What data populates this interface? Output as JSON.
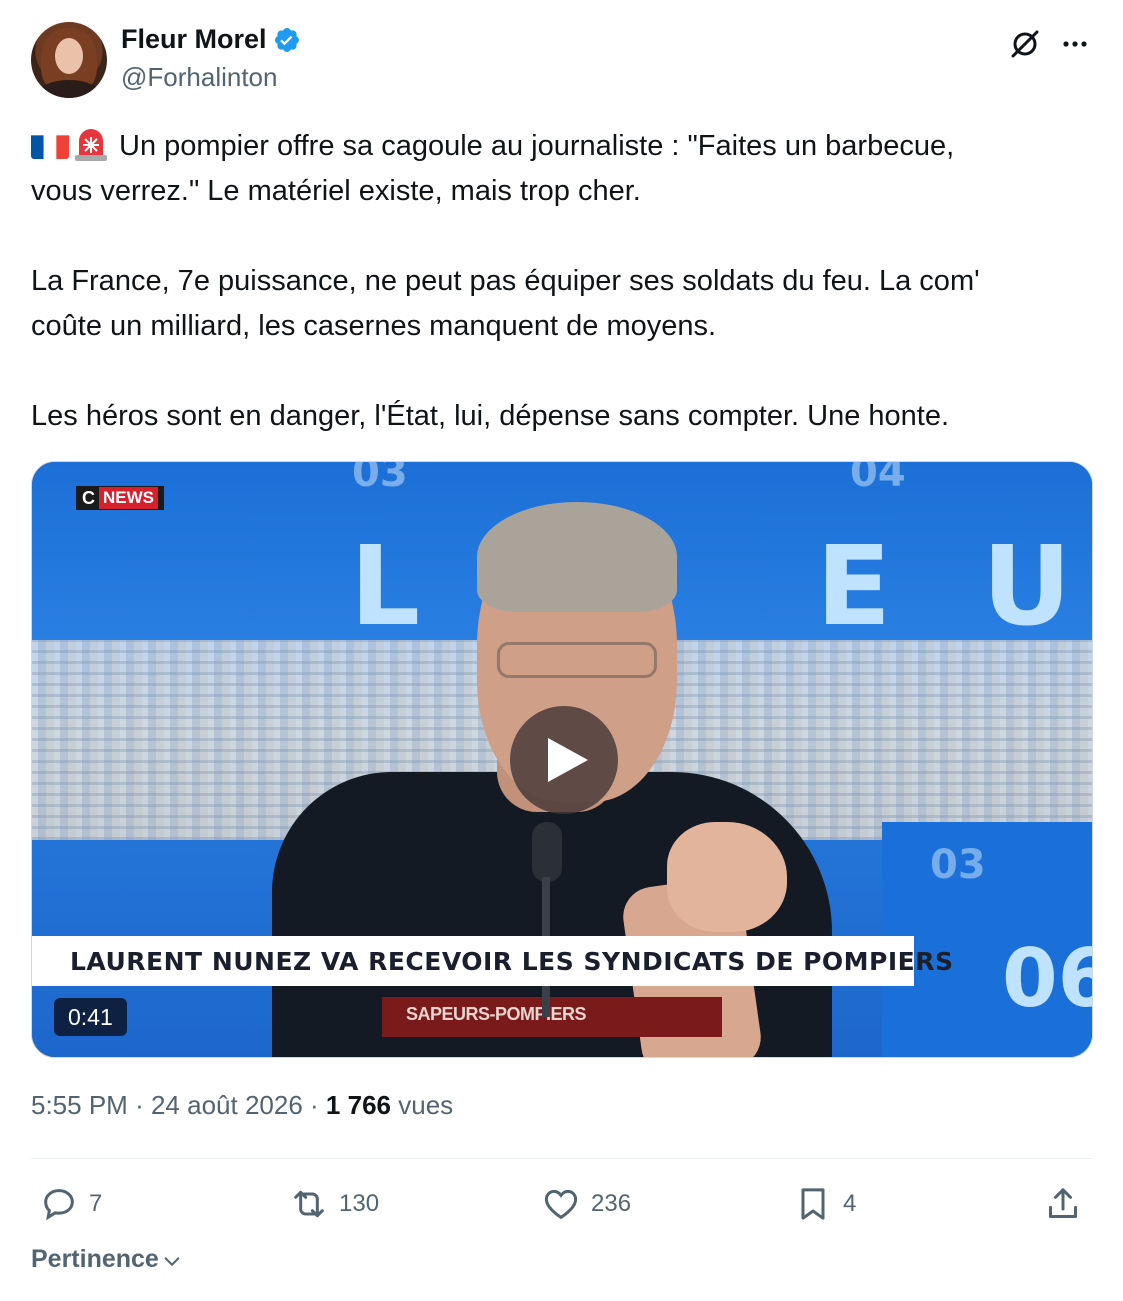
{
  "author": {
    "display_name": "Fleur Morel",
    "handle": "@Forhalinton",
    "verified": true
  },
  "header_icons": [
    "grok-icon",
    "more-icon"
  ],
  "tweet": {
    "line1": "Un pompier offre sa cagoule au journaliste : \"Faites un barbecue,",
    "line2": "vous verrez.\" Le matériel existe, mais trop cher.",
    "line3": "La France, 7e puissance, ne peut pas équiper ses soldats du feu. La com'",
    "line4": "coûte un milliard, les casernes manquent de moyens.",
    "line5": "Les héros sont en danger, l'État, lui, dépense sans compter. Une honte.",
    "emojis": [
      "french-flag-emoji",
      "rotating-light-emoji"
    ]
  },
  "media": {
    "channel_logo_c": "C",
    "channel_logo_news": "NEWS",
    "banner": "LAURENT NUNEZ VA RECEVOIR LES SYNDICATS DE POMPIERS",
    "shirt_text": "SAPEURS-POMPIERS",
    "duration": "0:41",
    "background_letters": [
      "L",
      "E",
      "U"
    ],
    "background_numbers": [
      "03",
      "04",
      "03",
      "06"
    ]
  },
  "meta": {
    "time": "5:55 PM",
    "separator": "·",
    "date": "24 août 2026",
    "views_count": "1 766",
    "views_label": "vues"
  },
  "actions": {
    "replies": "7",
    "reposts": "130",
    "likes": "236",
    "bookmarks": "4"
  },
  "sort": {
    "label": "Pertinence"
  },
  "colors": {
    "verified": "#1d9bf0",
    "text_primary": "#0f1419",
    "text_secondary": "#536471",
    "divider": "#eff3f4"
  }
}
